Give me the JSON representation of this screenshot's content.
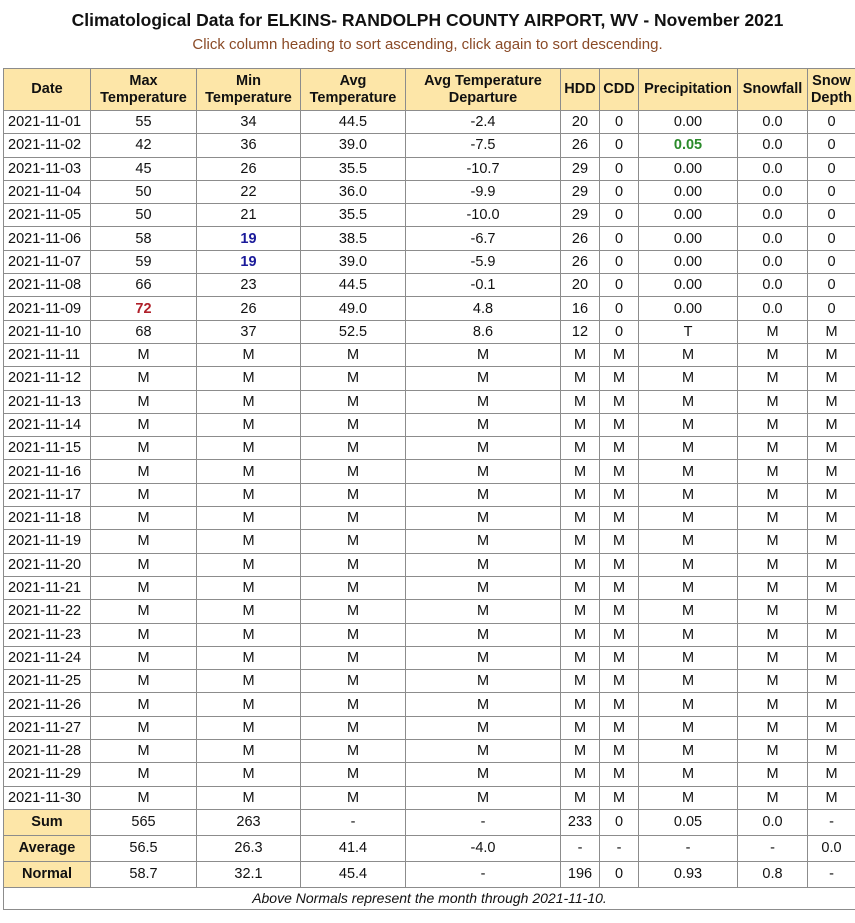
{
  "title": "Climatological Data for ELKINS- RANDOLPH COUNTY AIRPORT, WV - November 2021",
  "subtitle": "Click column heading to sort ascending, click again to sort descending.",
  "colors": {
    "header_bg": "#fde6a8",
    "record_high": "#b0202a",
    "record_low": "#1a1a9a",
    "precip_max": "#2a8a2a",
    "subtitle": "#8a4a26"
  },
  "columns": [
    {
      "line1": "Date",
      "line2": ""
    },
    {
      "line1": "Max",
      "line2": "Temperature"
    },
    {
      "line1": "Min",
      "line2": "Temperature"
    },
    {
      "line1": "Avg",
      "line2": "Temperature"
    },
    {
      "line1": "Avg Temperature",
      "line2": "Departure"
    },
    {
      "line1": "HDD",
      "line2": ""
    },
    {
      "line1": "CDD",
      "line2": ""
    },
    {
      "line1": "Precipitation",
      "line2": ""
    },
    {
      "line1": "Snowfall",
      "line2": ""
    },
    {
      "line1": "Snow",
      "line2": "Depth"
    }
  ],
  "rows": [
    {
      "date": "2021-11-01",
      "max": "55",
      "min": "34",
      "avg": "44.5",
      "dep": "-2.4",
      "hdd": "20",
      "cdd": "0",
      "pcp": "0.00",
      "snow": "0.0",
      "depth": "0"
    },
    {
      "date": "2021-11-02",
      "max": "42",
      "min": "36",
      "avg": "39.0",
      "dep": "-7.5",
      "hdd": "26",
      "cdd": "0",
      "pcp": "0.05",
      "snow": "0.0",
      "depth": "0",
      "pcp_hl": true
    },
    {
      "date": "2021-11-03",
      "max": "45",
      "min": "26",
      "avg": "35.5",
      "dep": "-10.7",
      "hdd": "29",
      "cdd": "0",
      "pcp": "0.00",
      "snow": "0.0",
      "depth": "0"
    },
    {
      "date": "2021-11-04",
      "max": "50",
      "min": "22",
      "avg": "36.0",
      "dep": "-9.9",
      "hdd": "29",
      "cdd": "0",
      "pcp": "0.00",
      "snow": "0.0",
      "depth": "0"
    },
    {
      "date": "2021-11-05",
      "max": "50",
      "min": "21",
      "avg": "35.5",
      "dep": "-10.0",
      "hdd": "29",
      "cdd": "0",
      "pcp": "0.00",
      "snow": "0.0",
      "depth": "0"
    },
    {
      "date": "2021-11-06",
      "max": "58",
      "min": "19",
      "avg": "38.5",
      "dep": "-6.7",
      "hdd": "26",
      "cdd": "0",
      "pcp": "0.00",
      "snow": "0.0",
      "depth": "0",
      "min_hl": true
    },
    {
      "date": "2021-11-07",
      "max": "59",
      "min": "19",
      "avg": "39.0",
      "dep": "-5.9",
      "hdd": "26",
      "cdd": "0",
      "pcp": "0.00",
      "snow": "0.0",
      "depth": "0",
      "min_hl": true
    },
    {
      "date": "2021-11-08",
      "max": "66",
      "min": "23",
      "avg": "44.5",
      "dep": "-0.1",
      "hdd": "20",
      "cdd": "0",
      "pcp": "0.00",
      "snow": "0.0",
      "depth": "0"
    },
    {
      "date": "2021-11-09",
      "max": "72",
      "min": "26",
      "avg": "49.0",
      "dep": "4.8",
      "hdd": "16",
      "cdd": "0",
      "pcp": "0.00",
      "snow": "0.0",
      "depth": "0",
      "max_hl": true
    },
    {
      "date": "2021-11-10",
      "max": "68",
      "min": "37",
      "avg": "52.5",
      "dep": "8.6",
      "hdd": "12",
      "cdd": "0",
      "pcp": "T",
      "snow": "M",
      "depth": "M"
    },
    {
      "date": "2021-11-11",
      "max": "M",
      "min": "M",
      "avg": "M",
      "dep": "M",
      "hdd": "M",
      "cdd": "M",
      "pcp": "M",
      "snow": "M",
      "depth": "M"
    },
    {
      "date": "2021-11-12",
      "max": "M",
      "min": "M",
      "avg": "M",
      "dep": "M",
      "hdd": "M",
      "cdd": "M",
      "pcp": "M",
      "snow": "M",
      "depth": "M"
    },
    {
      "date": "2021-11-13",
      "max": "M",
      "min": "M",
      "avg": "M",
      "dep": "M",
      "hdd": "M",
      "cdd": "M",
      "pcp": "M",
      "snow": "M",
      "depth": "M"
    },
    {
      "date": "2021-11-14",
      "max": "M",
      "min": "M",
      "avg": "M",
      "dep": "M",
      "hdd": "M",
      "cdd": "M",
      "pcp": "M",
      "snow": "M",
      "depth": "M"
    },
    {
      "date": "2021-11-15",
      "max": "M",
      "min": "M",
      "avg": "M",
      "dep": "M",
      "hdd": "M",
      "cdd": "M",
      "pcp": "M",
      "snow": "M",
      "depth": "M"
    },
    {
      "date": "2021-11-16",
      "max": "M",
      "min": "M",
      "avg": "M",
      "dep": "M",
      "hdd": "M",
      "cdd": "M",
      "pcp": "M",
      "snow": "M",
      "depth": "M"
    },
    {
      "date": "2021-11-17",
      "max": "M",
      "min": "M",
      "avg": "M",
      "dep": "M",
      "hdd": "M",
      "cdd": "M",
      "pcp": "M",
      "snow": "M",
      "depth": "M"
    },
    {
      "date": "2021-11-18",
      "max": "M",
      "min": "M",
      "avg": "M",
      "dep": "M",
      "hdd": "M",
      "cdd": "M",
      "pcp": "M",
      "snow": "M",
      "depth": "M"
    },
    {
      "date": "2021-11-19",
      "max": "M",
      "min": "M",
      "avg": "M",
      "dep": "M",
      "hdd": "M",
      "cdd": "M",
      "pcp": "M",
      "snow": "M",
      "depth": "M"
    },
    {
      "date": "2021-11-20",
      "max": "M",
      "min": "M",
      "avg": "M",
      "dep": "M",
      "hdd": "M",
      "cdd": "M",
      "pcp": "M",
      "snow": "M",
      "depth": "M"
    },
    {
      "date": "2021-11-21",
      "max": "M",
      "min": "M",
      "avg": "M",
      "dep": "M",
      "hdd": "M",
      "cdd": "M",
      "pcp": "M",
      "snow": "M",
      "depth": "M"
    },
    {
      "date": "2021-11-22",
      "max": "M",
      "min": "M",
      "avg": "M",
      "dep": "M",
      "hdd": "M",
      "cdd": "M",
      "pcp": "M",
      "snow": "M",
      "depth": "M"
    },
    {
      "date": "2021-11-23",
      "max": "M",
      "min": "M",
      "avg": "M",
      "dep": "M",
      "hdd": "M",
      "cdd": "M",
      "pcp": "M",
      "snow": "M",
      "depth": "M"
    },
    {
      "date": "2021-11-24",
      "max": "M",
      "min": "M",
      "avg": "M",
      "dep": "M",
      "hdd": "M",
      "cdd": "M",
      "pcp": "M",
      "snow": "M",
      "depth": "M"
    },
    {
      "date": "2021-11-25",
      "max": "M",
      "min": "M",
      "avg": "M",
      "dep": "M",
      "hdd": "M",
      "cdd": "M",
      "pcp": "M",
      "snow": "M",
      "depth": "M"
    },
    {
      "date": "2021-11-26",
      "max": "M",
      "min": "M",
      "avg": "M",
      "dep": "M",
      "hdd": "M",
      "cdd": "M",
      "pcp": "M",
      "snow": "M",
      "depth": "M"
    },
    {
      "date": "2021-11-27",
      "max": "M",
      "min": "M",
      "avg": "M",
      "dep": "M",
      "hdd": "M",
      "cdd": "M",
      "pcp": "M",
      "snow": "M",
      "depth": "M"
    },
    {
      "date": "2021-11-28",
      "max": "M",
      "min": "M",
      "avg": "M",
      "dep": "M",
      "hdd": "M",
      "cdd": "M",
      "pcp": "M",
      "snow": "M",
      "depth": "M"
    },
    {
      "date": "2021-11-29",
      "max": "M",
      "min": "M",
      "avg": "M",
      "dep": "M",
      "hdd": "M",
      "cdd": "M",
      "pcp": "M",
      "snow": "M",
      "depth": "M"
    },
    {
      "date": "2021-11-30",
      "max": "M",
      "min": "M",
      "avg": "M",
      "dep": "M",
      "hdd": "M",
      "cdd": "M",
      "pcp": "M",
      "snow": "M",
      "depth": "M"
    }
  ],
  "summary": [
    {
      "label": "Sum",
      "max": "565",
      "min": "263",
      "avg": "-",
      "dep": "-",
      "hdd": "233",
      "cdd": "0",
      "pcp": "0.05",
      "snow": "0.0",
      "depth": "-"
    },
    {
      "label": "Average",
      "max": "56.5",
      "min": "26.3",
      "avg": "41.4",
      "dep": "-4.0",
      "hdd": "-",
      "cdd": "-",
      "pcp": "-",
      "snow": "-",
      "depth": "0.0"
    },
    {
      "label": "Normal",
      "max": "58.7",
      "min": "32.1",
      "avg": "45.4",
      "dep": "-",
      "hdd": "196",
      "cdd": "0",
      "pcp": "0.93",
      "snow": "0.8",
      "depth": "-"
    }
  ],
  "footnote": "Above Normals represent the month through 2021-11-10."
}
